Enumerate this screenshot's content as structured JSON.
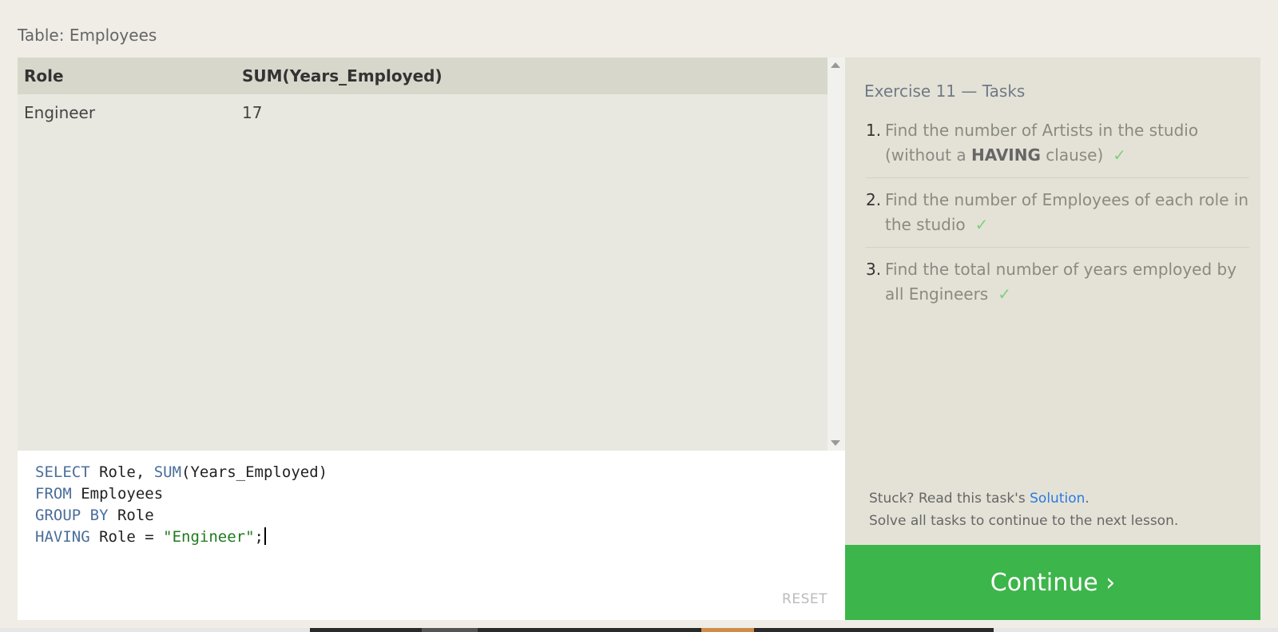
{
  "table_caption": "Table: Employees",
  "results": {
    "columns": [
      "Role",
      "SUM(Years_Employed)"
    ],
    "rows": [
      [
        "Engineer",
        "17"
      ]
    ]
  },
  "editor": {
    "line1": {
      "kw1": "SELECT",
      "rest1": " Role, ",
      "kw2": "SUM",
      "rest2": "(Years_Employed)"
    },
    "line2": {
      "kw": "FROM",
      "rest": " Employees"
    },
    "line3": {
      "kw": "GROUP BY",
      "rest": " Role"
    },
    "line4": {
      "kw": "HAVING",
      "rest": " Role = ",
      "str": "\"Engineer\"",
      "end": ";"
    },
    "reset_label": "RESET"
  },
  "tasks": {
    "title": "Exercise 11 — Tasks",
    "items": [
      {
        "num": "1.",
        "text_a": "Find the number of Artists in the studio (without a ",
        "bold": "HAVING",
        "text_b": " clause)",
        "check": "✓"
      },
      {
        "num": "2.",
        "text": "Find the number of Employees of each role in the studio",
        "check": "✓"
      },
      {
        "num": "3.",
        "text": "Find the total number of years employed by all Engineers",
        "check": "✓"
      }
    ],
    "stuck_prefix": "Stuck? Read this task's ",
    "solution_link": "Solution",
    "stuck_suffix": ".",
    "solve_all": "Solve all tasks to continue to the next lesson."
  },
  "continue_label": "Continue ›",
  "colors": {
    "accent_green": "#3cb54a",
    "link_blue": "#2a7ae2",
    "check_green": "#7fcf7f"
  }
}
